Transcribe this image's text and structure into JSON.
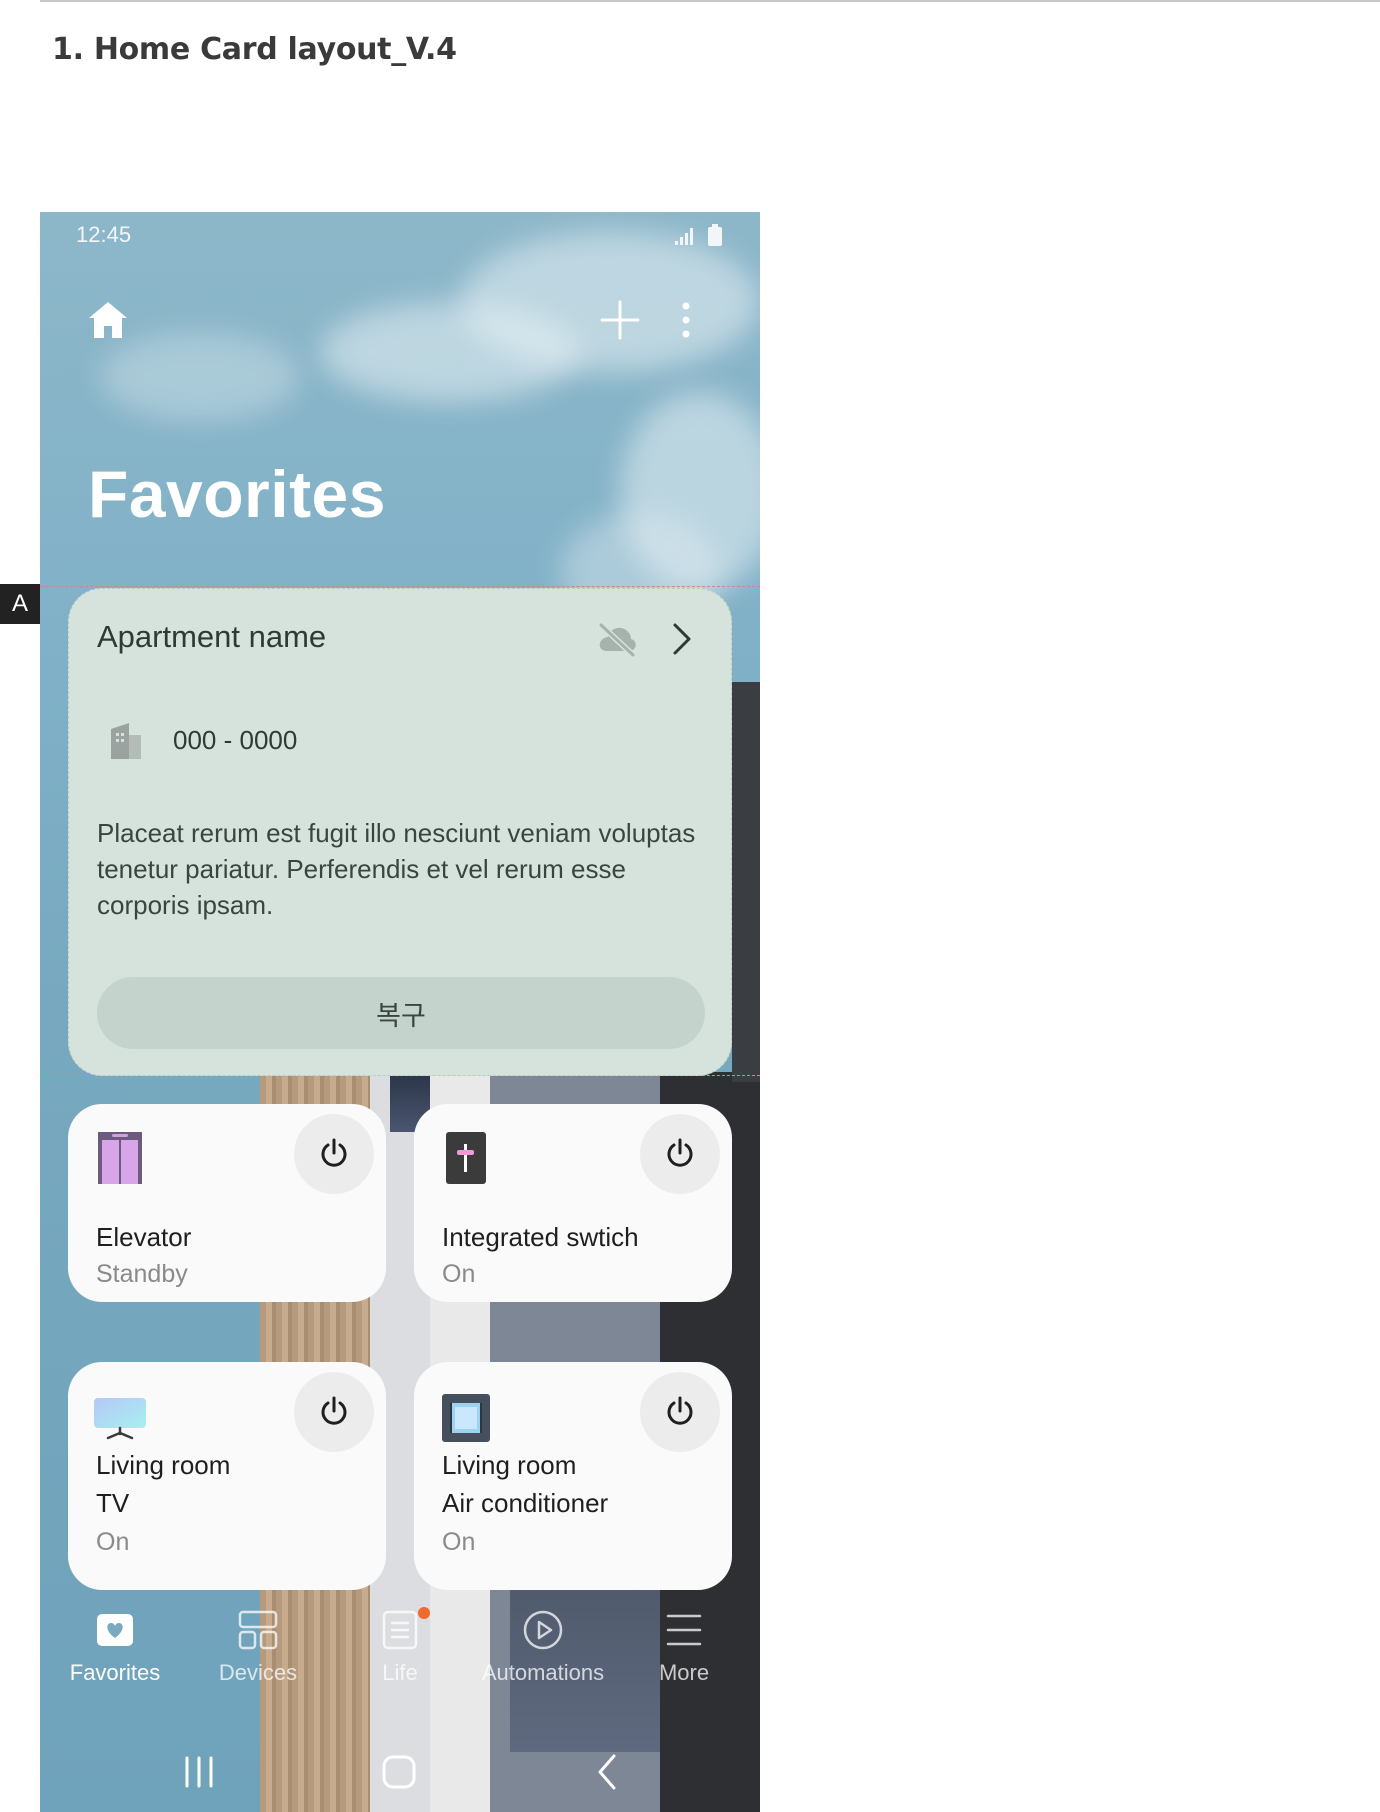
{
  "document": {
    "section_title": "1. Home Card layout_V.4",
    "marker_label": "A"
  },
  "status_bar": {
    "time": "12:45"
  },
  "header": {
    "title": "Favorites",
    "home_icon": "home-icon",
    "add_icon": "plus-icon",
    "more_icon": "more-vertical-icon"
  },
  "apartment_card": {
    "name": "Apartment name",
    "unit": "000 - 0000",
    "description": "Placeat rerum est fugit illo nesciunt veniam voluptas tenetur pariatur. Perferendis et vel rerum esse corporis ipsam.",
    "button_label": "복구",
    "cloud_icon": "cloud-off-icon",
    "chevron_icon": "chevron-right-icon",
    "building_icon": "building-icon"
  },
  "devices": [
    {
      "name_line1": "Elevator",
      "name_line2": "",
      "status": "Standby",
      "icon": "elevator-icon"
    },
    {
      "name_line1": "Integrated swtich",
      "name_line2": "",
      "status": "On",
      "icon": "switch-icon"
    },
    {
      "name_line1": "Living room",
      "name_line2": "TV",
      "status": "On",
      "icon": "tv-icon"
    },
    {
      "name_line1": "Living room",
      "name_line2": "Air conditioner",
      "status": "On",
      "icon": "air-conditioner-icon"
    }
  ],
  "bottom_nav": {
    "items": [
      {
        "label": "Favorites",
        "icon": "heart-icon",
        "active": true
      },
      {
        "label": "Devices",
        "icon": "devices-grid-icon",
        "active": false
      },
      {
        "label": "Life",
        "icon": "life-icon",
        "active": false
      },
      {
        "label": "Automations",
        "icon": "play-circle-icon",
        "active": false
      },
      {
        "label": "More",
        "icon": "menu-icon",
        "active": false
      }
    ]
  },
  "colors": {
    "sky": "#7fb0c7",
    "card_bg": "#d6e3dd",
    "device_card_bg": "#fafafa",
    "notification_dot": "#f06a2d"
  }
}
